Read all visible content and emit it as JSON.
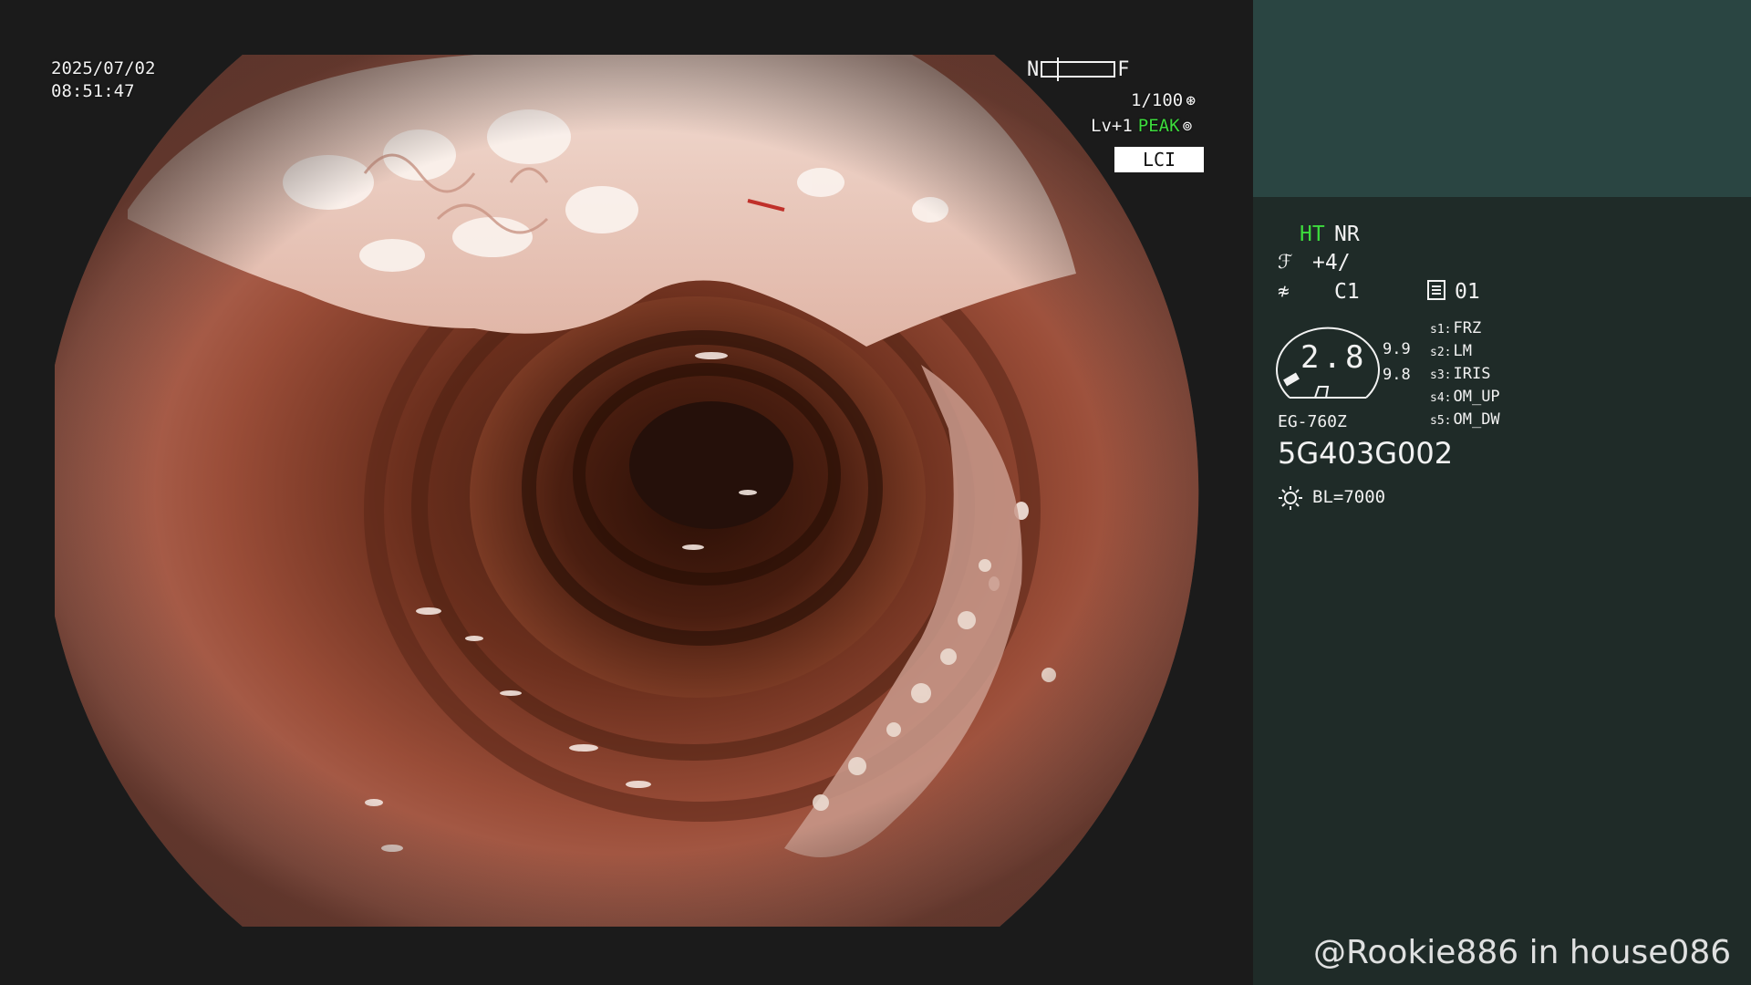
{
  "overlay": {
    "date": "2025/07/02",
    "time": "08:51:47",
    "nf_left": "N",
    "nf_right": "F",
    "shutter": "1/100",
    "level": "Lv+1",
    "peak": "PEAK",
    "mode_label": "LCI"
  },
  "panel": {
    "ht": "HT",
    "nr": "NR",
    "enhance": "+4/",
    "color": "C1",
    "memory": "01",
    "zoom": "2.8",
    "zoom_sub1": "9.9",
    "zoom_sub2": "9.8",
    "switches": [
      {
        "key": "s1:",
        "label": "FRZ"
      },
      {
        "key": "s2:",
        "label": "LM"
      },
      {
        "key": "s3:",
        "label": "IRIS"
      },
      {
        "key": "s4:",
        "label": "OM_UP"
      },
      {
        "key": "s5:",
        "label": "OM_DW"
      }
    ],
    "model": "EG-760Z",
    "serial": "5G403G002",
    "light": "BL=7000"
  },
  "watermark": "@Rookie886 in house086",
  "colors": {
    "peak_green": "#3ddc3d",
    "panel_top": "#2a4542",
    "panel_bottom": "#1f2b28"
  }
}
